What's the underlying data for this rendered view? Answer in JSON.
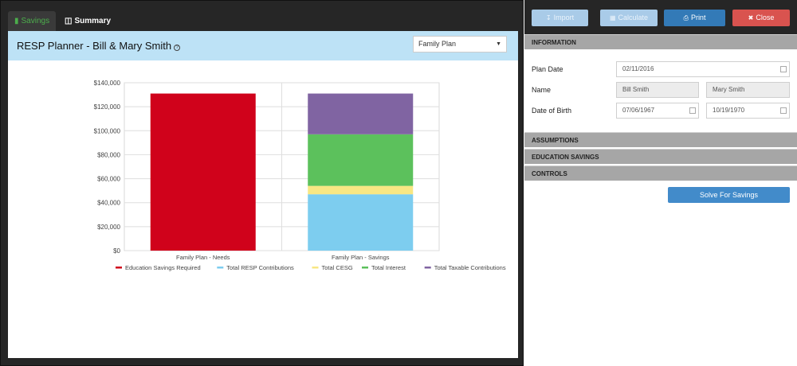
{
  "tabs": [
    {
      "label": "Savings",
      "icon": "bar-chart-icon"
    },
    {
      "label": "Summary",
      "icon": "book-icon"
    }
  ],
  "panel": {
    "title": "RESP Planner - Bill & Mary Smith",
    "plan_select": "Family Plan"
  },
  "chart_data": {
    "type": "bar",
    "stacked": true,
    "categories": [
      "Family Plan - Needs",
      "Family Plan - Savings"
    ],
    "ylim": [
      0,
      140000
    ],
    "yticks": [
      "$0",
      "$20,000",
      "$40,000",
      "$60,000",
      "$80,000",
      "$100,000",
      "$120,000",
      "$140,000"
    ],
    "series": [
      {
        "name": "Education Savings Required",
        "color": "#d0021b",
        "values": [
          131000,
          0
        ]
      },
      {
        "name": "Total RESP Contributions",
        "color": "#7dcdef",
        "values": [
          0,
          47000
        ]
      },
      {
        "name": "Total CESG",
        "color": "#f8e783",
        "values": [
          0,
          7000
        ]
      },
      {
        "name": "Total Interest",
        "color": "#5cc15c",
        "values": [
          0,
          43000
        ]
      },
      {
        "name": "Total Taxable Contributions",
        "color": "#8064a2",
        "values": [
          0,
          34000
        ]
      }
    ],
    "grid": true,
    "legend_position": "bottom"
  },
  "toolbar": {
    "import_label": "Import",
    "calculate_label": "Calculate",
    "print_label": "Print",
    "close_label": "Close"
  },
  "sections": {
    "information": "INFORMATION",
    "assumptions": "ASSUMPTIONS",
    "education_savings": "EDUCATION SAVINGS",
    "controls": "CONTROLS"
  },
  "form": {
    "plan_date_label": "Plan Date",
    "plan_date": "02/11/2016",
    "name_label": "Name",
    "name_1": "Bill Smith",
    "name_2": "Mary Smith",
    "dob_label": "Date of Birth",
    "dob_1": "07/06/1967",
    "dob_2": "10/19/1970"
  },
  "solve_label": "Solve For Savings",
  "colors": {
    "accent": "#337ab7",
    "danger": "#d9534f",
    "header_bg": "#bde2f6",
    "active_tab_text": "#4cae4c"
  }
}
